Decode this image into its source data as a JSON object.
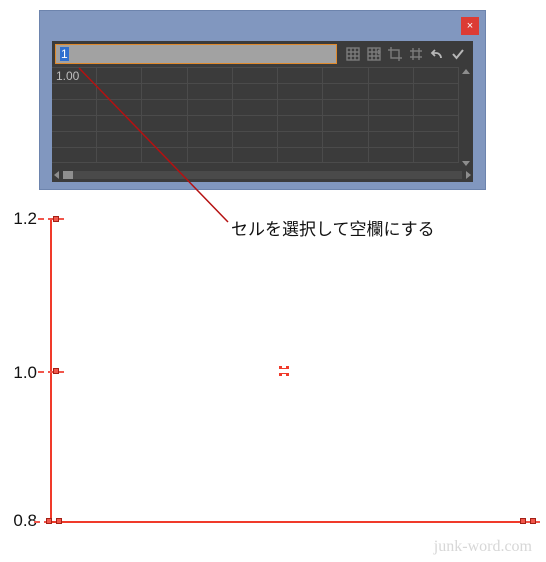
{
  "panel": {
    "close_label": "×",
    "input_value": "1",
    "first_cell_value": "1.00",
    "icon_colors": {
      "dim": "#7b7b7b",
      "bright": "#b8b8b8"
    }
  },
  "annotation": {
    "label": "セルを選択して空欄にする"
  },
  "axis": {
    "y_ticks": [
      "1.2",
      "1.0",
      "0.8"
    ]
  },
  "watermark": "junk-word.com"
}
